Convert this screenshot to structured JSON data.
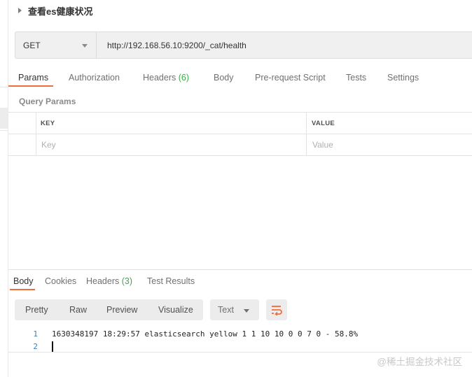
{
  "request": {
    "title": "查看es健康状况",
    "method": "GET",
    "url": "http://192.168.56.10:9200/_cat/health"
  },
  "request_tabs": {
    "params": "Params",
    "authorization": "Authorization",
    "headers": "Headers",
    "headers_count": "(6)",
    "body": "Body",
    "prerequest": "Pre-request Script",
    "tests": "Tests",
    "settings": "Settings"
  },
  "query_params": {
    "label": "Query Params",
    "col_key": "KEY",
    "col_value": "VALUE",
    "key_placeholder": "Key",
    "value_placeholder": "Value"
  },
  "response_tabs": {
    "body": "Body",
    "cookies": "Cookies",
    "headers": "Headers",
    "headers_count": "(3)",
    "test_results": "Test Results"
  },
  "response_toolbar": {
    "pretty": "Pretty",
    "raw": "Raw",
    "preview": "Preview",
    "visualize": "Visualize",
    "format": "Text"
  },
  "response_body": {
    "line1_no": "1",
    "line1": "1630348197 18:29:57 elasticsearch yellow 1 1 10 10 0 0 7 0 - 58.8%",
    "line2_no": "2",
    "line2": ""
  },
  "watermark": "@稀土掘金技术社区",
  "colors": {
    "accent": "#f26b3a",
    "count_green": "#3da84a",
    "line_number_blue": "#3d7fb8"
  },
  "icons": [
    "caret-right-icon",
    "chevron-down-icon",
    "wrap-lines-icon"
  ]
}
